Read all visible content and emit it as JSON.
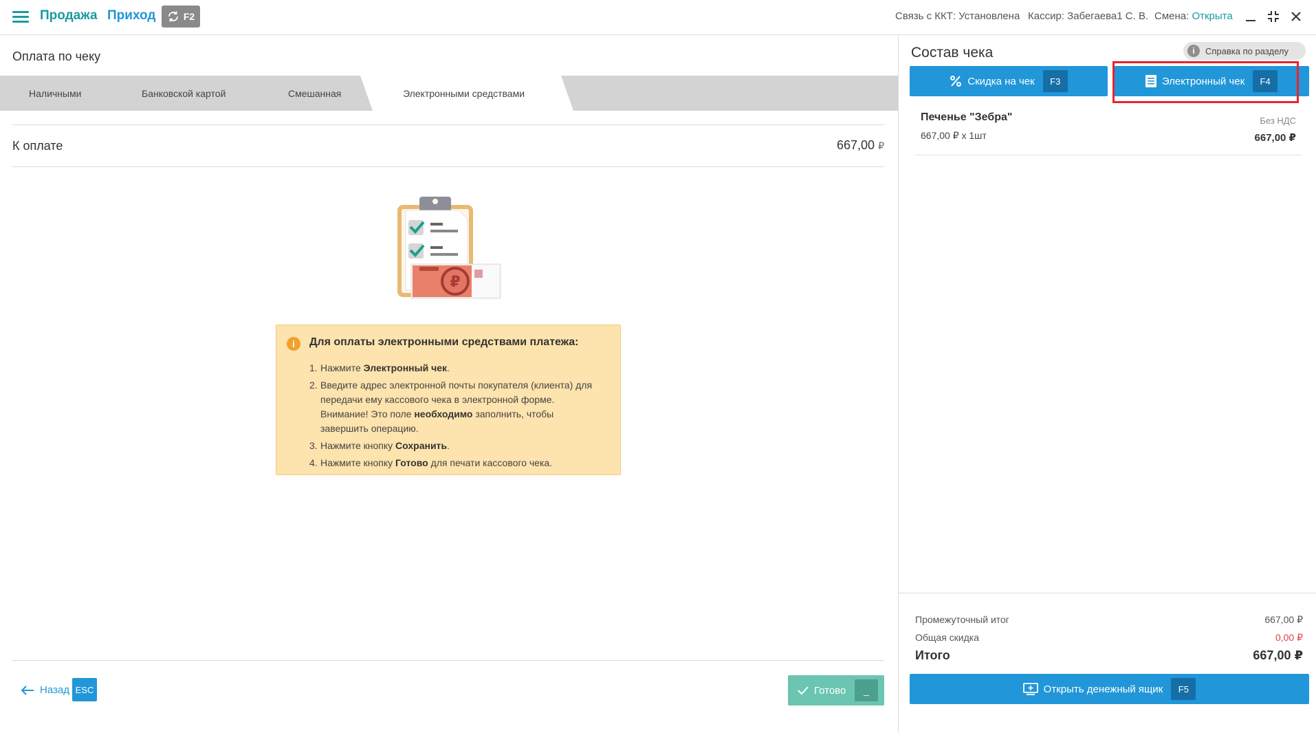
{
  "topbar": {
    "sale_label": "Продажа",
    "income_label": "Приход",
    "sync_key": "F2",
    "kkt_status": "Связь с ККТ: Установлена",
    "cashier": "Кассир: Забегаева1 С. В.",
    "shift_label": "Смена:",
    "shift_value": "Открыта",
    "icons": [
      "menu-icon",
      "sync-icon",
      "minimize-icon",
      "fullscreen-exit-icon",
      "close-icon"
    ]
  },
  "left": {
    "title": "Оплата по чеку",
    "tabs": [
      {
        "label": "Наличными",
        "active": false
      },
      {
        "label": "Банковской картой",
        "active": false
      },
      {
        "label": "Смешанная",
        "active": false
      },
      {
        "label": "Электронными средствами",
        "active": true
      }
    ],
    "to_pay_label": "К оплате",
    "to_pay_value": "667,00",
    "currency": "₽",
    "info": {
      "title": "Для оплаты электронными средствами платежа:",
      "items": [
        {
          "num": "1.",
          "pre": "Нажмите ",
          "bold": "Электронный чек",
          "post": "."
        },
        {
          "num": "2.",
          "pre": "Введите адрес электронной почты покупателя (клиента) для передачи ему кассового чека в электронной форме. Внимание! Это поле ",
          "bold": "необходимо",
          "post": " заполнить, чтобы завершить операцию."
        },
        {
          "num": "3.",
          "pre": "Нажмите кнопку ",
          "bold": "Сохранить",
          "post": "."
        },
        {
          "num": "4.",
          "pre": "Нажмите кнопку ",
          "bold": "Готово",
          "post": " для печати кассового чека."
        }
      ]
    },
    "back_label": "Назад",
    "back_key": "ESC",
    "done_label": "Готово",
    "done_key": "_"
  },
  "right": {
    "title": "Состав чека",
    "help_label": "Справка по разделу",
    "discount_label": "Скидка на чек",
    "discount_key": "F3",
    "echeck_label": "Электронный чек",
    "echeck_key": "F4",
    "item": {
      "name": "Печенье \"Зебра\"",
      "qty_line": "667,00 ₽ x 1шт",
      "vat": "Без НДС",
      "total": "667,00 ₽"
    },
    "subtotal_label": "Промежуточный итог",
    "subtotal_value": "667,00 ₽",
    "discount_total_label": "Общая скидка",
    "discount_total_value": "0,00 ₽",
    "grand_label": "Итого",
    "grand_value": "667,00 ₽",
    "drawer_label": "Открыть денежный ящик",
    "drawer_key": "F5"
  },
  "colors": {
    "accent_teal": "#1a9aa0",
    "primary_blue": "#2196d8",
    "key_blue": "#166ea7",
    "done_green": "#6cc5b0",
    "info_bg": "#fde3ad",
    "highlight_red": "#e8232a",
    "discount_red": "#e0414a"
  }
}
